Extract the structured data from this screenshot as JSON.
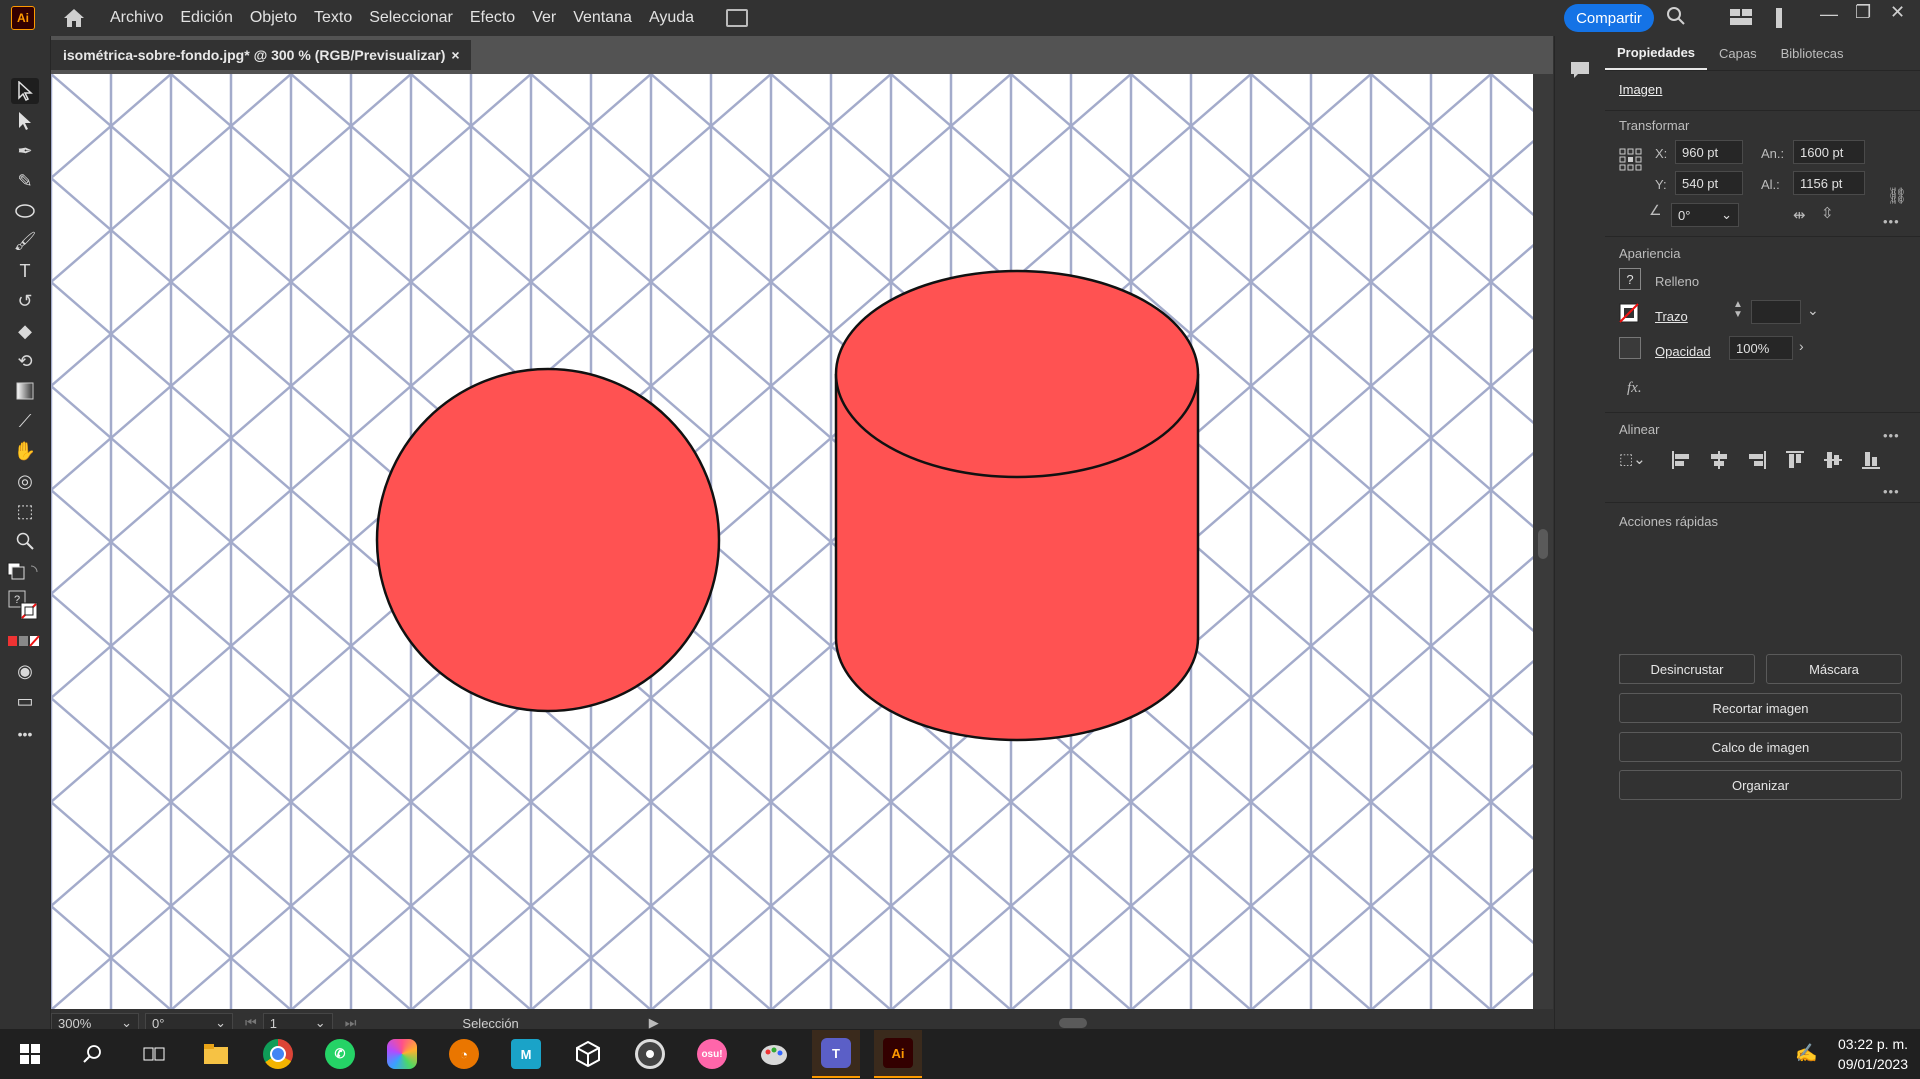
{
  "app": {
    "logo": "Ai"
  },
  "menu": [
    "Archivo",
    "Edición",
    "Objeto",
    "Texto",
    "Seleccionar",
    "Efecto",
    "Ver",
    "Ventana",
    "Ayuda"
  ],
  "share_label": "Compartir",
  "document": {
    "tab_title": "isométrica-sobre-fondo.jpg* @ 300 % (RGB/Previsualizar)",
    "close_glyph": "×"
  },
  "status": {
    "zoom": "300%",
    "rotation": "0°",
    "artboard": "1",
    "tool": "Selección"
  },
  "panel": {
    "tabs": [
      "Propiedades",
      "Capas",
      "Bibliotecas"
    ],
    "object_type": "Imagen",
    "transform": {
      "title": "Transformar",
      "x_label": "X:",
      "x": "960 pt",
      "y_label": "Y:",
      "y": "540 pt",
      "w_label": "An.:",
      "w": "1600 pt",
      "h_label": "Al.:",
      "h": "1156 pt",
      "angle": "0°"
    },
    "appearance": {
      "title": "Apariencia",
      "fill": "Relleno",
      "stroke": "Trazo",
      "opacity_label": "Opacidad",
      "opacity": "100%",
      "fx": "fx."
    },
    "align": {
      "title": "Alinear"
    },
    "quick_actions": {
      "title": "Acciones rápidas",
      "embed": "Desincrustar",
      "mask": "Máscara",
      "crop": "Recortar imagen",
      "trace": "Calco de imagen",
      "arrange": "Organizar"
    }
  },
  "taskbar": {
    "time": "03:22 p. m.",
    "date": "09/01/2023"
  },
  "colors": {
    "shape_fill": "#ff5252",
    "accent": "#1473e6",
    "grid": "#9aa3c7"
  }
}
